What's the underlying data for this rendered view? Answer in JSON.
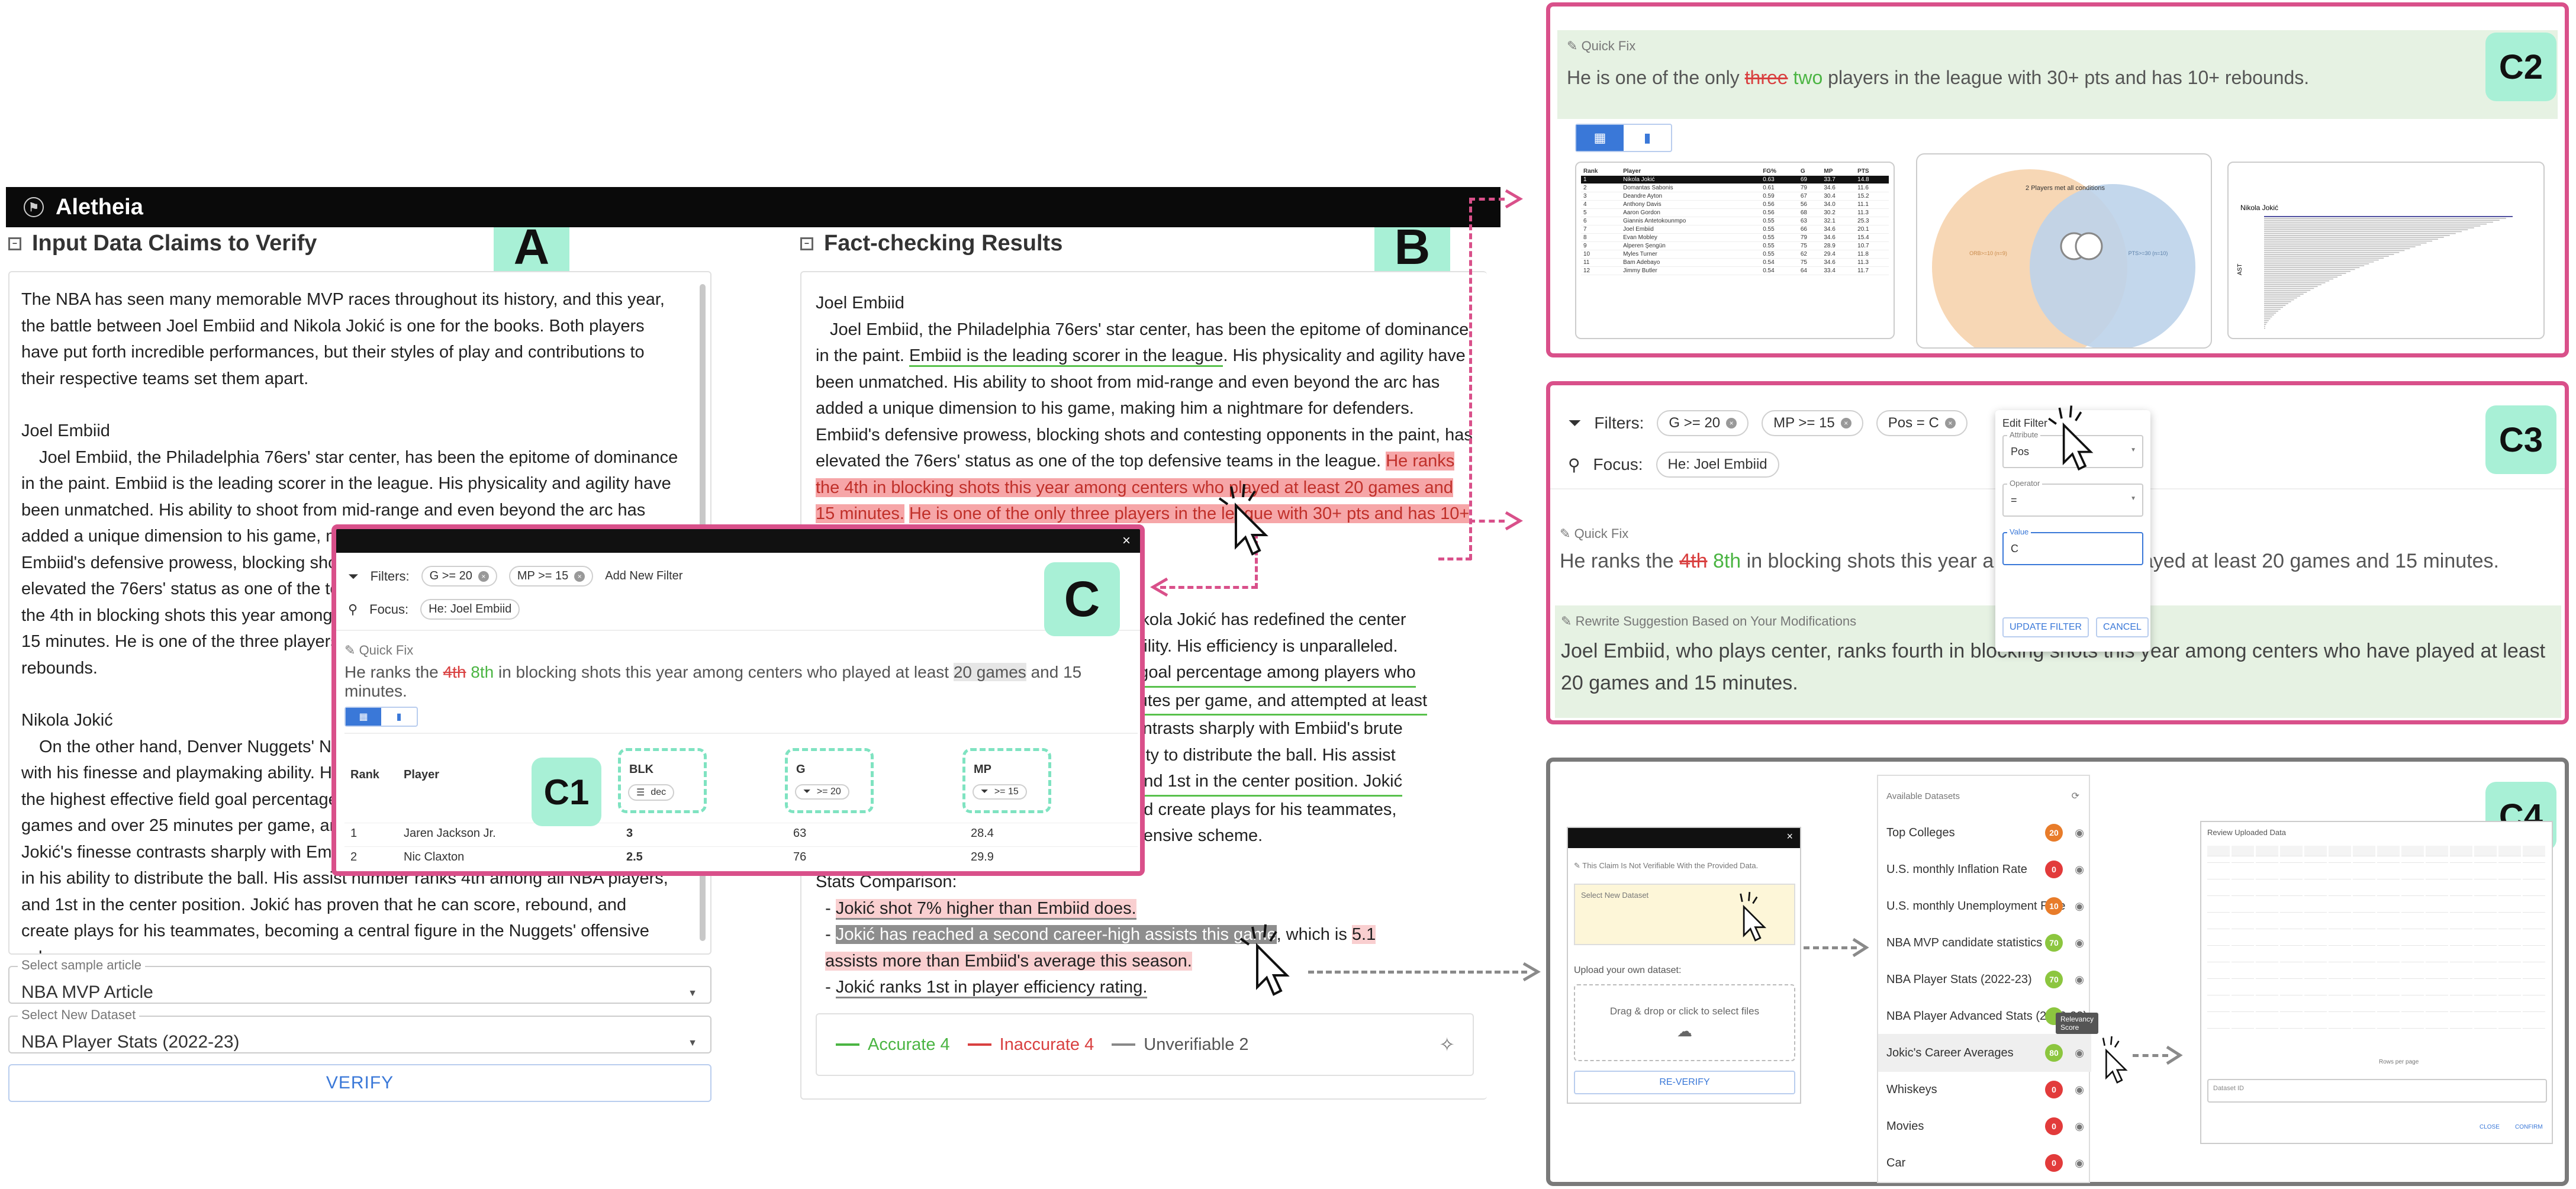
{
  "app": {
    "title": "Aletheia",
    "input_title": "Input Data Claims to Verify",
    "results_title": "Fact-checking Results"
  },
  "badges": {
    "a": "A",
    "b": "B",
    "c": "C",
    "c1": "C1",
    "c2": "C2",
    "c3": "C3",
    "c4": "C4"
  },
  "input": {
    "p1": "The NBA has seen many memorable MVP races throughout its history, and this year, the battle between Joel Embiid and Nikola Jokić is one for the books. Both players have put forth incredible performances, but their styles of play and contributions to their respective teams set them apart.",
    "h_embiid": "Joel Embiid",
    "p2": "Joel Embiid, the Philadelphia 76ers' star center, has been the epitome of dominance in the paint. Embiid is the leading scorer in the league. His physicality and agility have been unmatched. His ability to shoot from mid-range and even beyond the arc has added a unique dimension to his game, making him a nightmare for defenders. Embiid's defensive prowess, blocking shots and contesting opponents in the paint, has elevated the 76ers' status as one of the top defensive teams in the league. He ranks the 4th in blocking shots this year among centers who played at least 20 games and 15 minutes. He is one of the three players in the league with 30+ pts and has 10+ rebounds.",
    "h_jokic": "Nikola Jokić",
    "p3": "On the other hand, Denver Nuggets' Nikola Jokić has redefined the center position with his finesse and playmaking ability. His efficiency is unparalleled. Nikola Jokić has the highest effective field goal percentage among players who played at least 50 games and over 25 minutes per game, and attempted at least 10 field goals per game. Jokić's finesse contrasts sharply with Embiid's brute strength. His versatility is evident in his ability to distribute the ball. His assist number ranks 4th among all NBA players, and 1st in the center position. Jokić has proven that he can score, rebound, and create plays for his teammates, becoming a central figure in the Nuggets' offensive scheme.",
    "sample_label": "Select sample article",
    "sample_value": "NBA MVP Article",
    "dataset_label": "Select New Dataset",
    "dataset_value": "NBA Player Stats (2022-23)",
    "verify": "VERIFY"
  },
  "results": {
    "h_embiid": "Joel Embiid",
    "e1": "Joel Embiid, the Philadelphia 76ers' star center, has been the epitome of dominance in the paint. ",
    "e_claim1": "Embiid is the leading scorer in the league",
    "e2": ". His physicality and agility have been unmatched. His ability to shoot from mid-range and even beyond the arc has added a unique dimension to his game, making him a nightmare for defenders. Embiid's defensive prowess, blocking shots and contesting opponents in the paint, has elevated the 76ers' status as one of the top defensive teams in the league. ",
    "e_claim2": "He ranks the 4th in blocking shots this year among centers who played at least 20 games and 15 minutes.",
    "e_claim3": "He is one of the only three players in the league with 30+ pts and has 10+ rebounds.",
    "j1": "Nikola Jokić has redefined the center",
    "j2": "ability. His efficiency is unparalleled.",
    "j3": "d goal percentage among players who",
    "j4": "inutes per game, and attempted at least",
    "j5": "contrasts sharply with Embiid's brute",
    "j6": "bility to distribute the ball. His assist",
    "j7": ", and 1st in the center position. Jokić",
    "j8": "and create plays for his teammates,",
    "j9": "offensive scheme.",
    "stats_head": "Stats Comparison:",
    "s1": "Jokić shot 7% higher than Embiid does.",
    "s2": "Jokić has reached a second career-high assists this game",
    "s2b": ", which is ",
    "s2c": "5.1",
    "s2d": "assists more than Embiid's average this season.",
    "s3": "Jokić ranks 1st in player efficiency rating.",
    "legend_accurate": "Accurate 4",
    "legend_inaccurate": "Inaccurate 4",
    "legend_unverifiable": "Unverifiable 2"
  },
  "popup_c": {
    "filters_label": "Filters:",
    "chip1": "G >= 20",
    "chip2": "MP >= 15",
    "add_filter": "Add New Filter",
    "focus_label": "Focus:",
    "focus_chip": "He: Joel Embiid",
    "quickfix": "Quick Fix",
    "fix_pre": "He ranks the ",
    "fix_old": "4th",
    "fix_new": "8th",
    "fix_mid": " in blocking shots this year among centers who played at least ",
    "fix_hl": "20 games",
    "fix_post": " and 15 minutes.",
    "col_rank": "Rank",
    "col_player": "Player",
    "col_blk": "BLK",
    "col_g": "G",
    "col_mp": "MP",
    "blk_sort": "dec",
    "g_filter": ">= 20",
    "mp_filter": ">= 15",
    "rows": [
      {
        "rank": "1",
        "player": "Jaren Jackson Jr.",
        "blk": "3",
        "g": "63",
        "mp": "28.4"
      },
      {
        "rank": "2",
        "player": "Nic Claxton",
        "blk": "2.5",
        "g": "76",
        "mp": "29.9"
      }
    ]
  },
  "c2": {
    "quickfix": "Quick Fix",
    "pre": "He is one of the only ",
    "old": "three",
    "new": "two",
    "post": " players in the league with 30+ pts and has 10+ rebounds.",
    "venn_title": "2 Players met all conditions",
    "venn_left": "ORB>=10\n(n=9)",
    "venn_right": "PTS>=30\n(n=10)",
    "bar_title": "Nikola Jokić",
    "bar_ylabel": "AST",
    "table_cols": [
      "Rank",
      "Player",
      "FG%",
      "G",
      "MP",
      "PTS"
    ],
    "table_rows": [
      [
        "1",
        "Nikola Jokić",
        "0.63",
        "69",
        "33.7",
        "14.8"
      ],
      [
        "2",
        "Domantas Sabonis",
        "0.61",
        "79",
        "34.6",
        "11.6"
      ],
      [
        "3",
        "Deandre Ayton",
        "0.59",
        "67",
        "30.4",
        "15.2"
      ],
      [
        "4",
        "Anthony Davis",
        "0.56",
        "56",
        "34.0",
        "11.1"
      ],
      [
        "5",
        "Aaron Gordon",
        "0.56",
        "68",
        "30.2",
        "11.3"
      ],
      [
        "6",
        "Giannis Antetokounmpo",
        "0.55",
        "63",
        "32.1",
        "25.3"
      ],
      [
        "7",
        "Joel Embiid",
        "0.55",
        "66",
        "34.6",
        "20.1"
      ],
      [
        "8",
        "Evan Mobley",
        "0.55",
        "79",
        "34.6",
        "15.4"
      ],
      [
        "9",
        "Alperen Şengün",
        "0.55",
        "75",
        "28.9",
        "10.7"
      ],
      [
        "10",
        "Myles Turner",
        "0.55",
        "62",
        "29.4",
        "11.8"
      ],
      [
        "11",
        "Bam Adebayo",
        "0.54",
        "75",
        "34.6",
        "11.3"
      ],
      [
        "12",
        "Jimmy Butler",
        "0.54",
        "64",
        "33.4",
        "11.7"
      ]
    ]
  },
  "c3": {
    "filters_label": "Filters:",
    "chip1": "G >= 20",
    "chip2": "MP >= 15",
    "chip3": "Pos = C",
    "focus_label": "Focus:",
    "focus_chip": "He: Joel Embiid",
    "edit_title": "Edit Filter",
    "attr_label": "Attribute",
    "attr_value": "Pos",
    "op_label": "Operator",
    "op_value": "=",
    "val_label": "Value",
    "val_value": "C",
    "update": "UPDATE FILTER",
    "cancel": "CANCEL",
    "quickfix": "Quick Fix",
    "fix_pre": "He ranks the ",
    "fix_old": "4th",
    "fix_new": "8th",
    "fix_mid": " in blocking shots this year a",
    "fix_tail": "ayed at least 20 games and 15 minutes.",
    "rewrite_label": "Rewrite Suggestion Based on Your Modifications",
    "rewrite": "Joel Embiid, who plays center, ranks fourth in blocking shots this year among centers who have played at least 20 games and 15 minutes."
  },
  "c4": {
    "notice": "This Claim Is Not Verifiable With the Provided Data.",
    "select_ds": "Select New Dataset",
    "upload_label": "Upload your own dataset:",
    "drop": "Drag & drop or click to select files",
    "reverify": "RE-VERIFY",
    "available": "Available Datasets",
    "datasets": [
      {
        "name": "Top Colleges",
        "score": "20",
        "color": "#e87c2a"
      },
      {
        "name": "U.S. monthly Inflation Rate",
        "score": "0",
        "color": "#e23b3b"
      },
      {
        "name": "U.S. monthly Unemployment Rate",
        "score": "10",
        "color": "#e87c2a"
      },
      {
        "name": "NBA MVP candidate statistics",
        "score": "70",
        "color": "#8cc63f"
      },
      {
        "name": "NBA Player Stats (2022-23)",
        "score": "70",
        "color": "#8cc63f"
      },
      {
        "name": "NBA Player Advanced Stats (2022-23)",
        "score": "",
        "color": "#8cc63f"
      },
      {
        "name": "Jokic's Career Averages",
        "score": "80",
        "color": "#8cc63f"
      },
      {
        "name": "Whiskeys",
        "score": "0",
        "color": "#e23b3b"
      },
      {
        "name": "Movies",
        "score": "0",
        "color": "#e23b3b"
      },
      {
        "name": "Car",
        "score": "0",
        "color": "#e23b3b"
      }
    ],
    "tooltip": "Relevancy Score",
    "review_title": "Review Uploaded Data",
    "rows_per_page": "Rows per page",
    "dataset_id": "Dataset ID",
    "close": "CLOSE",
    "confirm": "CONFIRM"
  }
}
